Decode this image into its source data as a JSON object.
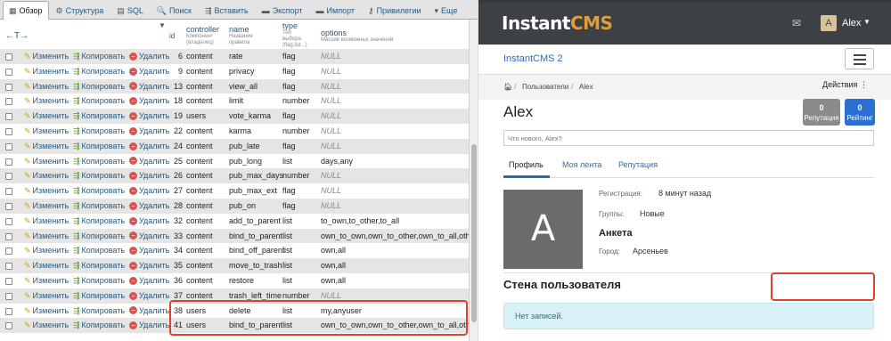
{
  "pma": {
    "tabs": [
      {
        "label": "Обзор",
        "icon": "browse-icon",
        "glyph": "▦"
      },
      {
        "label": "Структура",
        "icon": "structure-icon",
        "glyph": "⚙"
      },
      {
        "label": "SQL",
        "icon": "sql-icon",
        "glyph": "▤"
      },
      {
        "label": "Поиск",
        "icon": "search-icon",
        "glyph": "🔍"
      },
      {
        "label": "Вставить",
        "icon": "insert-icon",
        "glyph": "⇶"
      },
      {
        "label": "Экспорт",
        "icon": "export-icon",
        "glyph": "▬"
      },
      {
        "label": "Импорт",
        "icon": "import-icon",
        "glyph": "▬"
      },
      {
        "label": "Привилегии",
        "icon": "privileges-icon",
        "glyph": "⚷"
      },
      {
        "label": "Еще",
        "icon": "more-icon",
        "glyph": "▾"
      }
    ],
    "header": {
      "arrows": "←T→",
      "id": "id",
      "controller": "controller",
      "controller_sub1": "Компонент",
      "controller_sub2": "(владелец)",
      "name": "name",
      "name_sub1": "Название",
      "name_sub2": "правила",
      "type": "type",
      "type_sub1": "Тип",
      "type_sub2": "выбора",
      "type_sub3": "(flag,list...)",
      "options": "options",
      "options_sub": "Массив возможных значений"
    },
    "actions": {
      "edit": "Изменить",
      "copy": "Копировать",
      "delete": "Удалить"
    },
    "rows": [
      {
        "id": "6",
        "controller": "content",
        "name": "rate",
        "type": "flag",
        "options": "NULL",
        "null": true
      },
      {
        "id": "9",
        "controller": "content",
        "name": "privacy",
        "type": "flag",
        "options": "NULL",
        "null": true
      },
      {
        "id": "13",
        "controller": "content",
        "name": "view_all",
        "type": "flag",
        "options": "NULL",
        "null": true
      },
      {
        "id": "18",
        "controller": "content",
        "name": "limit",
        "type": "number",
        "options": "NULL",
        "null": true
      },
      {
        "id": "19",
        "controller": "users",
        "name": "vote_karma",
        "type": "flag",
        "options": "NULL",
        "null": true
      },
      {
        "id": "22",
        "controller": "content",
        "name": "karma",
        "type": "number",
        "options": "NULL",
        "null": true
      },
      {
        "id": "24",
        "controller": "content",
        "name": "pub_late",
        "type": "flag",
        "options": "NULL",
        "null": true
      },
      {
        "id": "25",
        "controller": "content",
        "name": "pub_long",
        "type": "list",
        "options": "days,any",
        "null": false
      },
      {
        "id": "26",
        "controller": "content",
        "name": "pub_max_days",
        "type": "number",
        "options": "NULL",
        "null": true
      },
      {
        "id": "27",
        "controller": "content",
        "name": "pub_max_ext",
        "type": "flag",
        "options": "NULL",
        "null": true
      },
      {
        "id": "28",
        "controller": "content",
        "name": "pub_on",
        "type": "flag",
        "options": "NULL",
        "null": true
      },
      {
        "id": "32",
        "controller": "content",
        "name": "add_to_parent",
        "type": "list",
        "options": "to_own,to_other,to_all",
        "null": false
      },
      {
        "id": "33",
        "controller": "content",
        "name": "bind_to_parent",
        "type": "list",
        "options": "own_to_own,own_to_other,own_to_all,other_to",
        "null": false
      },
      {
        "id": "34",
        "controller": "content",
        "name": "bind_off_parent",
        "type": "list",
        "options": "own,all",
        "null": false
      },
      {
        "id": "35",
        "controller": "content",
        "name": "move_to_trash",
        "type": "list",
        "options": "own,all",
        "null": false
      },
      {
        "id": "36",
        "controller": "content",
        "name": "restore",
        "type": "list",
        "options": "own,all",
        "null": false
      },
      {
        "id": "37",
        "controller": "content",
        "name": "trash_left_time",
        "type": "number",
        "options": "NULL",
        "null": true
      },
      {
        "id": "38",
        "controller": "users",
        "name": "delete",
        "type": "list",
        "options": "my,anyuser",
        "null": false
      },
      {
        "id": "41",
        "controller": "users",
        "name": "bind_to_parent",
        "type": "list",
        "options": "own_to_own,own_to_other,own_to_all,other_to",
        "null": false
      }
    ]
  },
  "cms": {
    "logo_main": "Instant",
    "logo_accent": "CMS",
    "user_avatar_letter": "A",
    "user_name": "Alex",
    "site_title": "InstantCMS 2",
    "breadcrumb_users": "Пользователи",
    "breadcrumb_sep1": "/",
    "breadcrumb_sep2": "/",
    "breadcrumb_current": "Alex",
    "actions_label": "Действия",
    "profile_name": "Alex",
    "reputation_value": "0",
    "reputation_label": "Репутация",
    "rating_value": "0",
    "rating_label": "Рейтинг",
    "status_placeholder": "Что нового, Alex?",
    "tabs": [
      "Профиль",
      "Моя лента",
      "Репутация"
    ],
    "avatar_letter": "A",
    "registration_label": "Регистрация:",
    "registration_value": "8 минут назад",
    "groups_label": "Группы:",
    "groups_value": "Новые",
    "anketa_title": "Анкета",
    "city_label": "Город:",
    "city_value": "Арсеньев",
    "wall_title": "Стена пользователя",
    "wall_empty": "Нет записей.",
    "colors": {
      "navbar": "#3d4146",
      "accent": "#e39c3a",
      "link": "#2b6bb2",
      "highlight": "#e0402e"
    }
  }
}
